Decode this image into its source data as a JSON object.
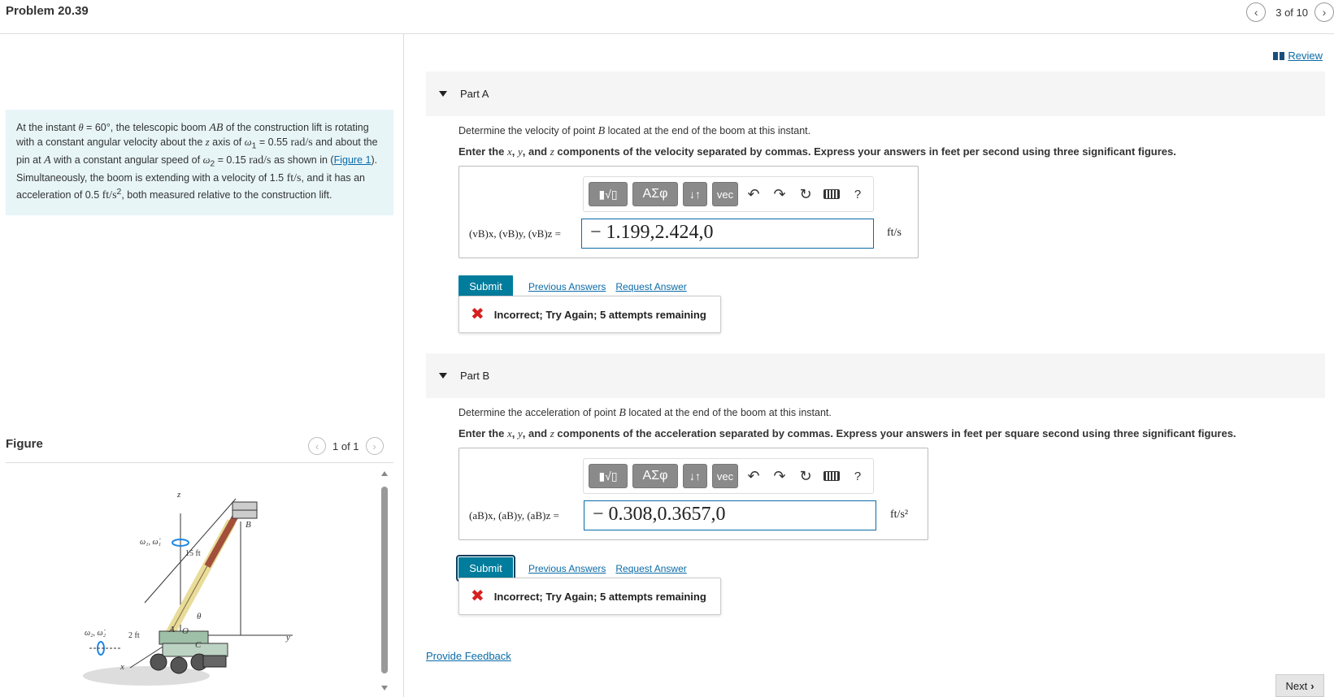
{
  "header": {
    "title": "Problem 20.39",
    "pager": "3 of 10"
  },
  "problem": {
    "t1": "At the instant ",
    "theta": "θ",
    "t2": " = 60°, the telescopic boom ",
    "ab": "AB",
    "t3": " of the construction lift is rotating with a constant angular velocity about the ",
    "z": "z",
    "t4": " axis of ",
    "w1": "ω",
    "w1sub": "1",
    "t5": " = 0.55 ",
    "rad1": "rad/s",
    "t6": " and about the pin at ",
    "a": "A",
    "t7": " with a constant angular speed of ",
    "w2": "ω",
    "w2sub": "2",
    "t8": " = 0.15 ",
    "rad2": "rad/s",
    "t9": " as shown in (",
    "fig_link": "Figure 1",
    "t10": "). Simultaneously, the boom is extending with a velocity of 1.5 ",
    "fts": "ft/s",
    "t11": ", and it has an acceleration of 0.5 ",
    "fts2": "ft/s",
    "sq": "2",
    "t12": ", both measured relative to the construction lift."
  },
  "figure": {
    "label": "Figure",
    "pager": "1 of 1",
    "labels": {
      "z": "z",
      "y": "y",
      "x": "x",
      "B": "B",
      "A": "A",
      "O": "O",
      "C": "C",
      "theta": "θ",
      "w1": "ω₁, ω̇₁",
      "w2": "ω₂, ω̇₂",
      "len15": "15 ft",
      "len2": "2 ft"
    }
  },
  "review": "Review",
  "toolbar": {
    "sym": "ΑΣφ",
    "arr": "↓↑",
    "vec": "vec",
    "help": "?"
  },
  "partA": {
    "title": "Part A",
    "question_pre": "Determine the velocity of point ",
    "question_var": "B",
    "question_post": " located at the end of the boom at this instant.",
    "instr_1": "Enter the ",
    "instr_x": "x",
    "instr_2": ", ",
    "instr_y": "y",
    "instr_3": ", and ",
    "instr_z": "z",
    "instr_4": " components of the velocity separated by commas. Express your answers in feet per second using three significant figures.",
    "input_label": "(vB)x, (vB)y, (vB)z =",
    "input_value": "− 1.199,2.424,0",
    "unit": "ft/s",
    "submit": "Submit",
    "prev": "Previous Answers",
    "request": "Request Answer",
    "feedback": "Incorrect; Try Again; 5 attempts remaining"
  },
  "partB": {
    "title": "Part B",
    "question_pre": "Determine the acceleration of point ",
    "question_var": "B",
    "question_post": " located at the end of the boom at this instant.",
    "instr_1": "Enter the ",
    "instr_x": "x",
    "instr_2": ", ",
    "instr_y": "y",
    "instr_3": ", and ",
    "instr_z": "z",
    "instr_4": " components of the acceleration separated by commas. Express your answers in feet per square second using three significant figures.",
    "input_label": "(aB)x, (aB)y, (aB)z =",
    "input_value": "− 0.308,0.3657,0",
    "unit": "ft/s²",
    "submit": "Submit",
    "prev": "Previous Answers",
    "request": "Request Answer",
    "feedback": "Incorrect; Try Again; 5 attempts remaining"
  },
  "footer": {
    "provide_feedback": "Provide Feedback",
    "next": "Next"
  }
}
